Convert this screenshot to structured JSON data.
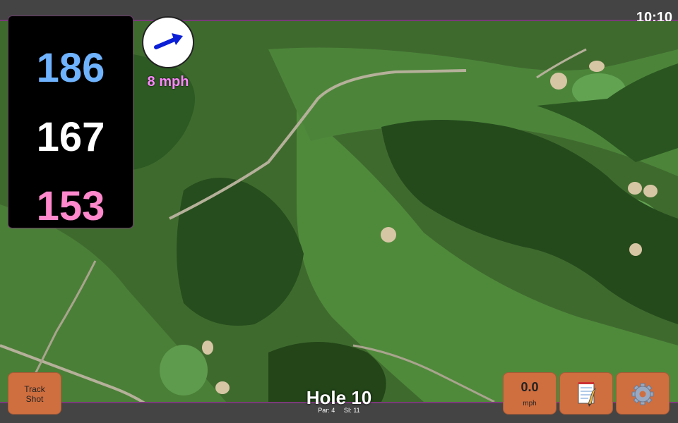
{
  "status_bar": {
    "time": "10:10"
  },
  "distances": {
    "back": "186",
    "middle": "167",
    "front": "153"
  },
  "wind": {
    "speed": "8 mph",
    "icon": "wind-direction-arrow-icon"
  },
  "hole": {
    "title": "Hole 10",
    "par": "Par: 4",
    "stroke_index": "SI: 11"
  },
  "buttons": {
    "track_shot": {
      "line1": "Track",
      "line2": "Shot"
    },
    "speed": {
      "value": "0.0",
      "unit": "mph"
    },
    "notes_icon": "notepad-icon",
    "settings_icon": "gear-icon"
  },
  "colors": {
    "back": "#6fb3ff",
    "middle": "#ffffff",
    "front": "#ff88cc",
    "wind_text": "#ff88ff",
    "button": "#cf6e3f",
    "bar": "#444444",
    "accent": "#7a3a7a"
  }
}
